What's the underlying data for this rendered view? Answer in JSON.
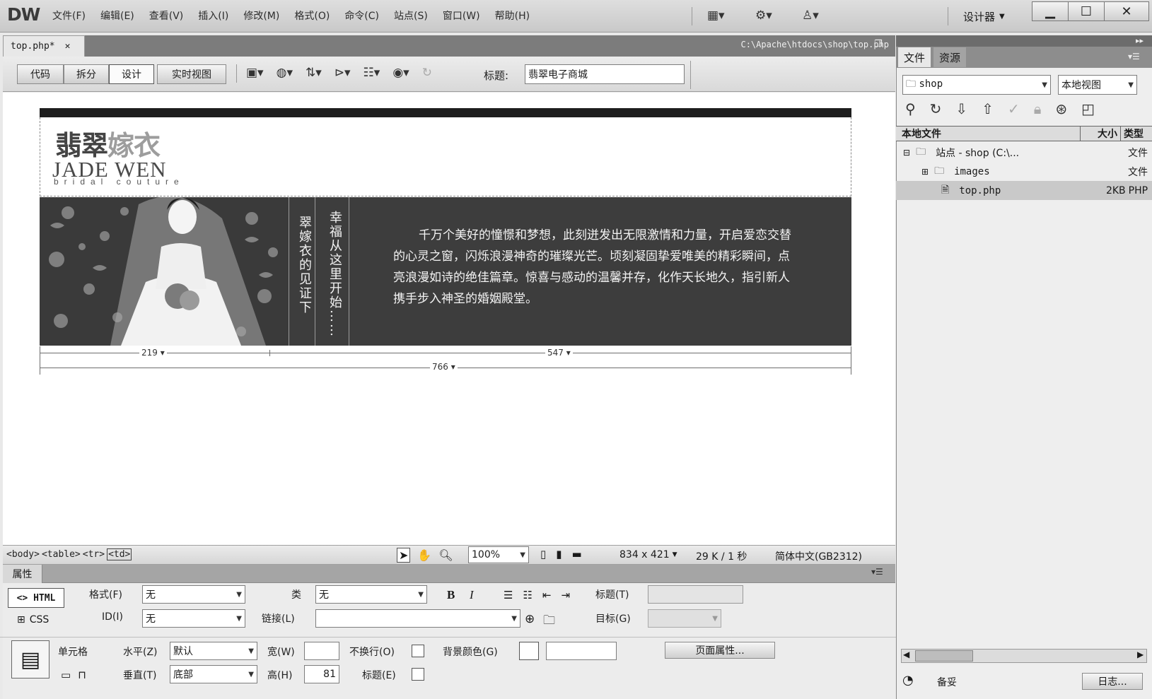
{
  "app": {
    "logo": "DW",
    "workspace": "设计器"
  },
  "menu": [
    "文件(F)",
    "编辑(E)",
    "查看(V)",
    "插入(I)",
    "修改(M)",
    "格式(O)",
    "命令(C)",
    "站点(S)",
    "窗口(W)",
    "帮助(H)"
  ],
  "window_controls": {
    "minimize": "▁",
    "maximize": "☐",
    "close": "✕"
  },
  "document": {
    "tab_label": "top.php*",
    "tab_close": "✕",
    "path": "C:\\Apache\\htdocs\\shop\\top.php",
    "view_buttons": [
      "代码",
      "拆分",
      "设计",
      "实时视图"
    ],
    "active_view": "设计",
    "title_label": "标题:",
    "title_value": "翡翠电子商城"
  },
  "banner": {
    "logo_cn_dark": "翡翠",
    "logo_cn_light": "嫁衣",
    "logo_en": "JADE WEN",
    "logo_sub": "bridal couture",
    "vertical_1": "翠嫁衣的见证下",
    "vertical_2": "幸福从这里开始……",
    "paragraph": "千万个美好的憧憬和梦想，此刻迸发出无限激情和力量，开启爱恋交替的心灵之窗，闪烁浪漫神奇的璀璨光芒。顷刻凝固挚爱唯美的精彩瞬间，点亮浪漫如诗的绝佳篇章。惊喜与感动的温馨并存，化作天长地久，指引新人携手步入神圣的婚姻殿堂。",
    "col_width_1": "219",
    "col_width_2": "547",
    "table_width": "766"
  },
  "statusbar": {
    "tags": [
      "<body>",
      "<table>",
      "<tr>",
      "<td>"
    ],
    "zoom": "100%",
    "dimensions": "834 x 421",
    "size_time": "29 K / 1 秒",
    "encoding": "简体中文(GB2312)"
  },
  "properties": {
    "header": "属性",
    "html_btn": "<> HTML",
    "css_btn": "CSS",
    "format_label": "格式(F)",
    "format_value": "无",
    "id_label": "ID(I)",
    "id_value": "无",
    "class_label": "类",
    "class_value": "无",
    "link_label": "链接(L)",
    "link_value": "",
    "bold": "B",
    "italic": "I",
    "heading_label": "标题(T)",
    "target_label": "目标(G)",
    "cell_label": "单元格",
    "horz_label": "水平(Z)",
    "horz_value": "默认",
    "vert_label": "垂直(T)",
    "vert_value": "底部",
    "width_label": "宽(W)",
    "width_value": "",
    "height_label": "高(H)",
    "height_value": "81",
    "nowrap_label": "不换行(O)",
    "header_label": "标题(E)",
    "bgcolor_label": "背景颜色(G)",
    "page_props_btn": "页面属性..."
  },
  "files_panel": {
    "tabs": [
      "文件",
      "资源"
    ],
    "site": "shop",
    "view": "本地视图",
    "col_local": "本地文件",
    "col_size": "大小",
    "col_type": "类型",
    "rows": [
      {
        "name": "站点 - shop (C:\\...",
        "size": "",
        "type": "文件"
      },
      {
        "name": "images",
        "size": "",
        "type": "文件"
      },
      {
        "name": "top.php",
        "size": "2KB",
        "type": "PHP"
      }
    ],
    "status": "备妥",
    "log_btn": "日志..."
  }
}
